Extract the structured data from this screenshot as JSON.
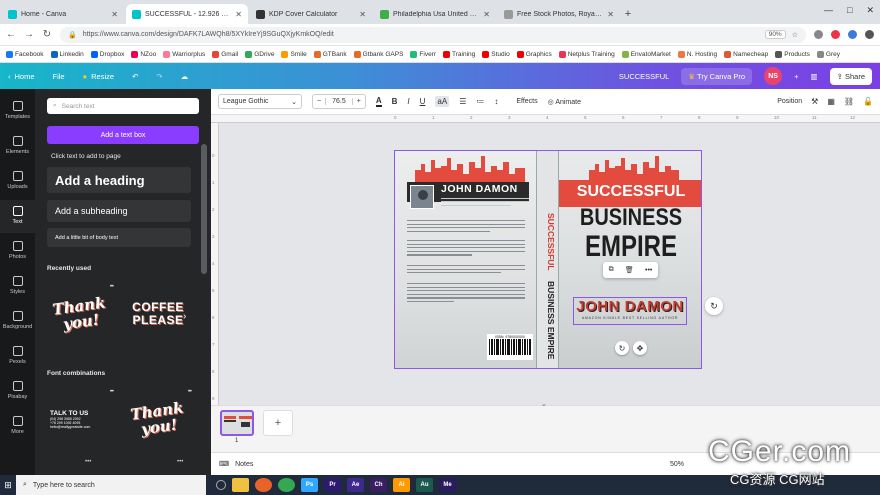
{
  "browser": {
    "tabs": [
      {
        "title": "Home - Canva",
        "color": "#00c4cc",
        "active": false
      },
      {
        "title": "SUCCESSFUL - 12.926 × 9.25in",
        "color": "#00c4cc",
        "active": true
      },
      {
        "title": "KDP Cover Calculator",
        "color": "#333333",
        "active": false
      },
      {
        "title": "Philadelphia Usa United States",
        "color": "#3fae49",
        "active": false
      },
      {
        "title": "Free Stock Photos, Royalty Free",
        "color": "#999999",
        "active": false
      }
    ],
    "new_tab": "+",
    "url": "https://www.canva.com/design/DAFK7LAWQh8/5XYkIreYj9SGuQXjyKmkOQ/edit",
    "zoom": "90%"
  },
  "bookmarks": [
    "Facebook",
    "Linkedin",
    "Dropbox",
    "NZoo",
    "Warriorplus",
    "Gmail",
    "GDrive",
    "Smile",
    "GTBank",
    "Gtbank GAPS",
    "Fiverr",
    "Training",
    "Studio",
    "Graphics",
    "Netplus Training",
    "EnvatoMarket",
    "N. Hosting",
    "Namecheap",
    "Products",
    "Grey"
  ],
  "canva_header": {
    "home": "Home",
    "file": "File",
    "resize": "Resize",
    "design_title": "SUCCESSFUL",
    "try_pro": "Try Canva Pro",
    "avatar": "NS",
    "share": "Share"
  },
  "rail": [
    {
      "label": "Templates",
      "icon": "templates-icon"
    },
    {
      "label": "Elements",
      "icon": "elements-icon"
    },
    {
      "label": "Uploads",
      "icon": "uploads-icon"
    },
    {
      "label": "Text",
      "icon": "text-icon",
      "active": true
    },
    {
      "label": "Photos",
      "icon": "photos-icon"
    },
    {
      "label": "Styles",
      "icon": "styles-icon"
    },
    {
      "label": "Background",
      "icon": "background-icon"
    },
    {
      "label": "Pexels",
      "icon": "pexels-icon"
    },
    {
      "label": "Pixabay",
      "icon": "pixabay-icon"
    },
    {
      "label": "More",
      "icon": "more-icon"
    }
  ],
  "panel": {
    "search_placeholder": "Search text",
    "add_textbox": "Add a text box",
    "click_hint": "Click text to add to page",
    "heading": "Add a heading",
    "subheading": "Add a subheading",
    "body": "Add a little bit of body text",
    "recently_used": "Recently used",
    "font_combinations": "Font combinations",
    "thumb_thankyou": "Thank you!",
    "thumb_coffee": "COFFEE PLEASE",
    "thumb_talk": "TALK TO US",
    "talk_lines": [
      "(04) 298 3985 2092",
      "+76 209 1092 4095",
      "hello@reallygreatsite.com"
    ],
    "thumb_thankyou2": "Thank you!"
  },
  "toolbar": {
    "font": "League Gothic",
    "font_size": "76.5",
    "effects": "Effects",
    "animate": "Animate",
    "position": "Position"
  },
  "ruler": [
    "0",
    "1",
    "2",
    "3",
    "4",
    "5",
    "6",
    "7",
    "8",
    "9",
    "10",
    "11",
    "12",
    "13"
  ],
  "vruler": [
    "0",
    "1",
    "2",
    "3",
    "4",
    "5",
    "6",
    "7",
    "8",
    "9"
  ],
  "cover": {
    "author": "JOHN DAMON",
    "spine_title": "SUCCESSFUL",
    "spine_subtitle": "BUSINESS EMPIRE",
    "title_line1": "SUCCESSFUL",
    "title_line2": "BUSINESS",
    "title_line3": "EMPIRE",
    "front_author": "JOHN DAMON",
    "front_tagline": "AMAZON KINDLE BEST SELLING AUTHOR",
    "isbn": "ISBN: 9780000000"
  },
  "pages": {
    "page_number": "1",
    "add": "+"
  },
  "notes": {
    "label": "Notes",
    "zoom": "50%"
  },
  "taskbar": {
    "search": "Type here to search",
    "apps": [
      {
        "label": "Ps",
        "color": "#31a8ff"
      },
      {
        "label": "Pr",
        "color": "#2d1a6e"
      },
      {
        "label": "Ae",
        "color": "#3e2a8c"
      },
      {
        "label": "Ch",
        "color": "#3a1d62"
      },
      {
        "label": "Ai",
        "color": "#ff9a00"
      },
      {
        "label": "Au",
        "color": "#1a5a4f"
      },
      {
        "label": "Me",
        "color": "#2a1a5e"
      }
    ]
  },
  "watermark": {
    "big": "CGer.com",
    "small": "CG资源 CG网站"
  }
}
